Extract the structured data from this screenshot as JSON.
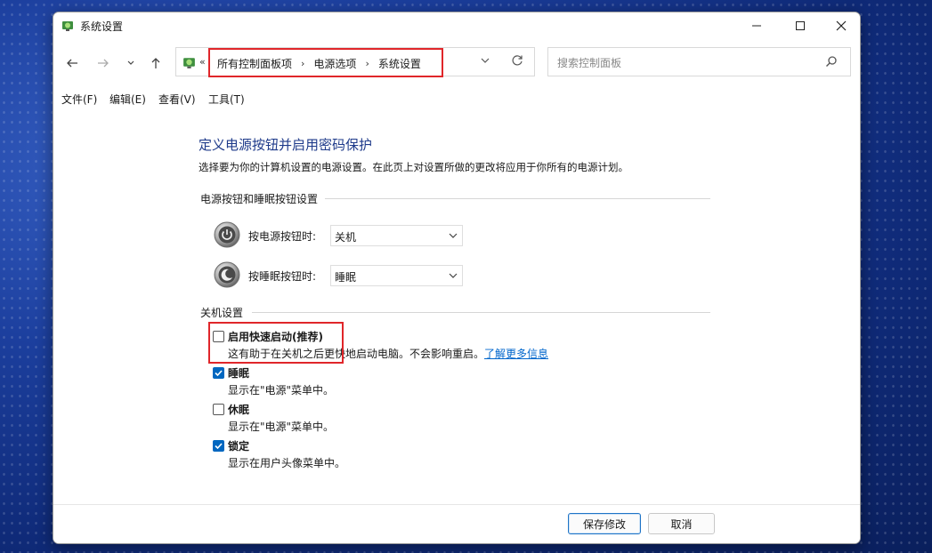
{
  "window": {
    "title": "系统设置"
  },
  "address": {
    "prefix": "«",
    "breadcrumbs": [
      "所有控制面板项",
      "电源选项",
      "系统设置"
    ],
    "separator": "›"
  },
  "search": {
    "placeholder": "搜索控制面板"
  },
  "menu": {
    "items": [
      "文件(F)",
      "编辑(E)",
      "查看(V)",
      "工具(T)"
    ]
  },
  "page": {
    "title": "定义电源按钮并启用密码保护",
    "description": "选择要为你的计算机设置的电源设置。在此页上对设置所做的更改将应用于你所有的电源计划。"
  },
  "buttons_section": {
    "heading": "电源按钮和睡眠按钮设置",
    "power_label": "按电源按钮时:",
    "power_value": "关机",
    "sleep_label": "按睡眠按钮时:",
    "sleep_value": "睡眠"
  },
  "shutdown_section": {
    "heading": "关机设置",
    "options": [
      {
        "label": "启用快速启动(推荐)",
        "desc": "这有助于在关机之后更快地启动电脑。不会影响重启。",
        "link": "了解更多信息",
        "checked": false
      },
      {
        "label": "睡眠",
        "desc": "显示在\"电源\"菜单中。",
        "checked": true
      },
      {
        "label": "休眠",
        "desc": "显示在\"电源\"菜单中。",
        "checked": false
      },
      {
        "label": "锁定",
        "desc": "显示在用户头像菜单中。",
        "checked": true
      }
    ]
  },
  "footer": {
    "save": "保存修改",
    "cancel": "取消"
  },
  "colors": {
    "accent": "#0067c0",
    "title_blue": "#1e3a8a",
    "highlight_red": "#e0262a"
  }
}
